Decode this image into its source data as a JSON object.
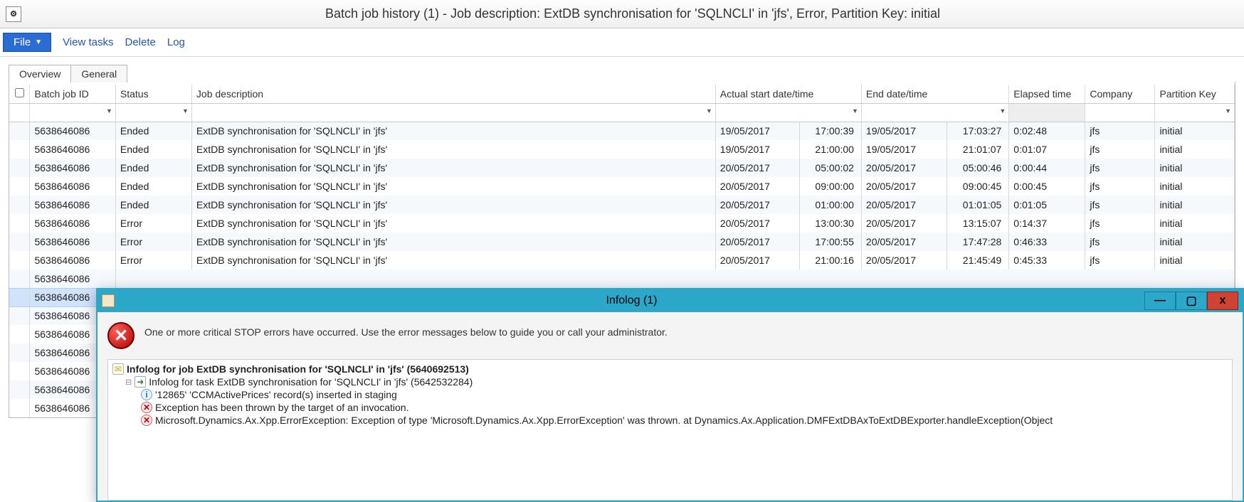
{
  "window": {
    "title": "Batch job history (1) - Job description: ExtDB synchronisation for 'SQLNCLI' in 'jfs', Error, Partition Key: initial"
  },
  "menu": {
    "file": "File",
    "view_tasks": "View tasks",
    "delete": "Delete",
    "log": "Log"
  },
  "tabs": {
    "overview": "Overview",
    "general": "General"
  },
  "columns": {
    "batch_id": "Batch job ID",
    "status": "Status",
    "desc": "Job description",
    "start": "Actual start date/time",
    "end": "End date/time",
    "elapsed": "Elapsed time",
    "company": "Company",
    "partition": "Partition Key"
  },
  "rows": [
    {
      "id": "5638646086",
      "status": "Ended",
      "desc": "ExtDB synchronisation for 'SQLNCLI' in 'jfs'",
      "sdate": "19/05/2017",
      "stime": "17:00:39",
      "edate": "19/05/2017",
      "etime": "17:03:27",
      "elapsed": "0:02:48",
      "company": "jfs",
      "part": "initial"
    },
    {
      "id": "5638646086",
      "status": "Ended",
      "desc": "ExtDB synchronisation for 'SQLNCLI' in 'jfs'",
      "sdate": "19/05/2017",
      "stime": "21:00:00",
      "edate": "19/05/2017",
      "etime": "21:01:07",
      "elapsed": "0:01:07",
      "company": "jfs",
      "part": "initial"
    },
    {
      "id": "5638646086",
      "status": "Ended",
      "desc": "ExtDB synchronisation for 'SQLNCLI' in 'jfs'",
      "sdate": "20/05/2017",
      "stime": "05:00:02",
      "edate": "20/05/2017",
      "etime": "05:00:46",
      "elapsed": "0:00:44",
      "company": "jfs",
      "part": "initial"
    },
    {
      "id": "5638646086",
      "status": "Ended",
      "desc": "ExtDB synchronisation for 'SQLNCLI' in 'jfs'",
      "sdate": "20/05/2017",
      "stime": "09:00:00",
      "edate": "20/05/2017",
      "etime": "09:00:45",
      "elapsed": "0:00:45",
      "company": "jfs",
      "part": "initial"
    },
    {
      "id": "5638646086",
      "status": "Ended",
      "desc": "ExtDB synchronisation for 'SQLNCLI' in 'jfs'",
      "sdate": "20/05/2017",
      "stime": "01:00:00",
      "edate": "20/05/2017",
      "etime": "01:01:05",
      "elapsed": "0:01:05",
      "company": "jfs",
      "part": "initial"
    },
    {
      "id": "5638646086",
      "status": "Error",
      "desc": "ExtDB synchronisation for 'SQLNCLI' in 'jfs'",
      "sdate": "20/05/2017",
      "stime": "13:00:30",
      "edate": "20/05/2017",
      "etime": "13:15:07",
      "elapsed": "0:14:37",
      "company": "jfs",
      "part": "initial"
    },
    {
      "id": "5638646086",
      "status": "Error",
      "desc": "ExtDB synchronisation for 'SQLNCLI' in 'jfs'",
      "sdate": "20/05/2017",
      "stime": "17:00:55",
      "edate": "20/05/2017",
      "etime": "17:47:28",
      "elapsed": "0:46:33",
      "company": "jfs",
      "part": "initial"
    },
    {
      "id": "5638646086",
      "status": "Error",
      "desc": "ExtDB synchronisation for 'SQLNCLI' in 'jfs'",
      "sdate": "20/05/2017",
      "stime": "21:00:16",
      "edate": "20/05/2017",
      "etime": "21:45:49",
      "elapsed": "0:45:33",
      "company": "jfs",
      "part": "initial"
    }
  ],
  "partial_rows": [
    "5638646086",
    "5638646086",
    "5638646086",
    "5638646086",
    "5638646086",
    "5638646086",
    "5638646086",
    "5638646086"
  ],
  "infolog": {
    "title": "Infolog (1)",
    "summary": "One or more critical STOP errors have occurred. Use the error messages below to guide you or call your administrator.",
    "tree": {
      "root": "Infolog for job ExtDB synchronisation for 'SQLNCLI' in 'jfs' (5640692513)",
      "task": "Infolog for task ExtDB synchronisation for 'SQLNCLI' in 'jfs' (5642532284)",
      "info": "'12865' 'CCMActivePrices' record(s) inserted in staging",
      "err1": "Exception has been thrown by the target of an invocation.",
      "err2": "Microsoft.Dynamics.Ax.Xpp.ErrorException: Exception of type 'Microsoft.Dynamics.Ax.Xpp.ErrorException' was thrown.   at Dynamics.Ax.Application.DMFExtDBAxToExtDBExporter.handleException(Object"
    },
    "buttons": {
      "min": "—",
      "max": "▢",
      "close": "x"
    }
  }
}
